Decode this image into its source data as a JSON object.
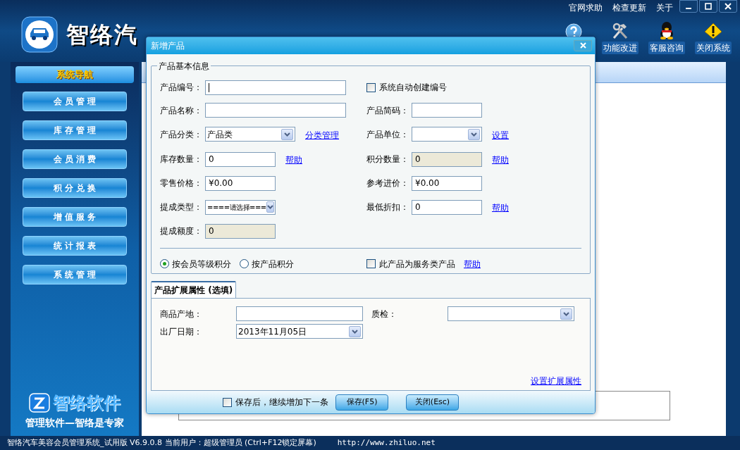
{
  "top_links": [
    "官网求助",
    "检查更新",
    "关于"
  ],
  "app_title": "智络汽",
  "toolbar": [
    {
      "kind": "help"
    },
    {
      "kind": "tools",
      "label": "功能改进"
    },
    {
      "kind": "support",
      "label": "客服咨询"
    },
    {
      "kind": "warning",
      "label": "关闭系统"
    }
  ],
  "sidebar": {
    "title": "系统导航",
    "items": [
      "会 员 管 理",
      "库 存 管 理",
      "会 员 消 费",
      "积 分 兑 换",
      "增 值 服 务",
      "统 计 报 表",
      "系 统 管 理"
    ]
  },
  "brand": {
    "name": "智络软件",
    "slogan": "管理软件—智络是专家"
  },
  "dialog": {
    "title": "新增产品",
    "basic": {
      "title": "产品基本信息",
      "rows": [
        {
          "left": {
            "kind": "longtext",
            "label": "产品编号：",
            "focused": true
          },
          "right": {
            "kind": "checkbox",
            "label": "系统自动创建编号",
            "checked": false
          }
        },
        {
          "left": {
            "kind": "longtext",
            "label": "产品名称："
          },
          "right": {
            "kind": "text",
            "label": "产品简码："
          }
        },
        {
          "left": {
            "kind": "longselect",
            "label": "产品分类：",
            "value": "产品类",
            "link": "分类管理"
          },
          "right": {
            "kind": "select",
            "label": "产品单位：",
            "link": "设置"
          }
        },
        {
          "left": {
            "kind": "text",
            "label": "库存数量：",
            "value": "0",
            "link": "帮助"
          },
          "right": {
            "kind": "text",
            "label": "积分数量：",
            "value": "0",
            "disabled": true,
            "link": "帮助"
          }
        },
        {
          "left": {
            "kind": "text",
            "label": "零售价格：",
            "value": "¥0.00"
          },
          "right": {
            "kind": "text",
            "label": "参考进价：",
            "value": "¥0.00"
          }
        },
        {
          "left": {
            "kind": "select",
            "label": "提成类型：",
            "value": "====请选择==="
          },
          "right": {
            "kind": "text",
            "label": "最低折扣：",
            "value": "0",
            "link": "帮助"
          }
        },
        {
          "left": {
            "kind": "text",
            "label": "提成额度：",
            "value": "0",
            "disabled": true
          }
        }
      ],
      "radios": [
        {
          "label": "按会员等级积分",
          "selected": true
        },
        {
          "label": "按产品积分",
          "selected": false
        }
      ],
      "service": {
        "label": "此产品为服务类产品",
        "checked": false,
        "link": "帮助"
      }
    },
    "extension": {
      "tab": "产品扩展属性 (选填)",
      "rows": [
        {
          "left": {
            "kind": "text",
            "label": "商品产地："
          },
          "right": {
            "kind": "select",
            "label": "质检："
          }
        },
        {
          "left": {
            "kind": "select",
            "label": "出厂日期：",
            "value": "2013年11月05日"
          }
        }
      ],
      "link": "设置扩展属性"
    },
    "continue": {
      "label": "保存后，继续增加下一条",
      "checked": false
    },
    "buttons": [
      "保存(F5)",
      "关闭(Esc)"
    ]
  },
  "status_bar": {
    "info": "智络汽车美容会员管理系统_试用版 V6.9.0.8 当前用户：超级管理员 (Ctrl+F12锁定屏幕)",
    "url": "http://www.zhiluo.net"
  }
}
